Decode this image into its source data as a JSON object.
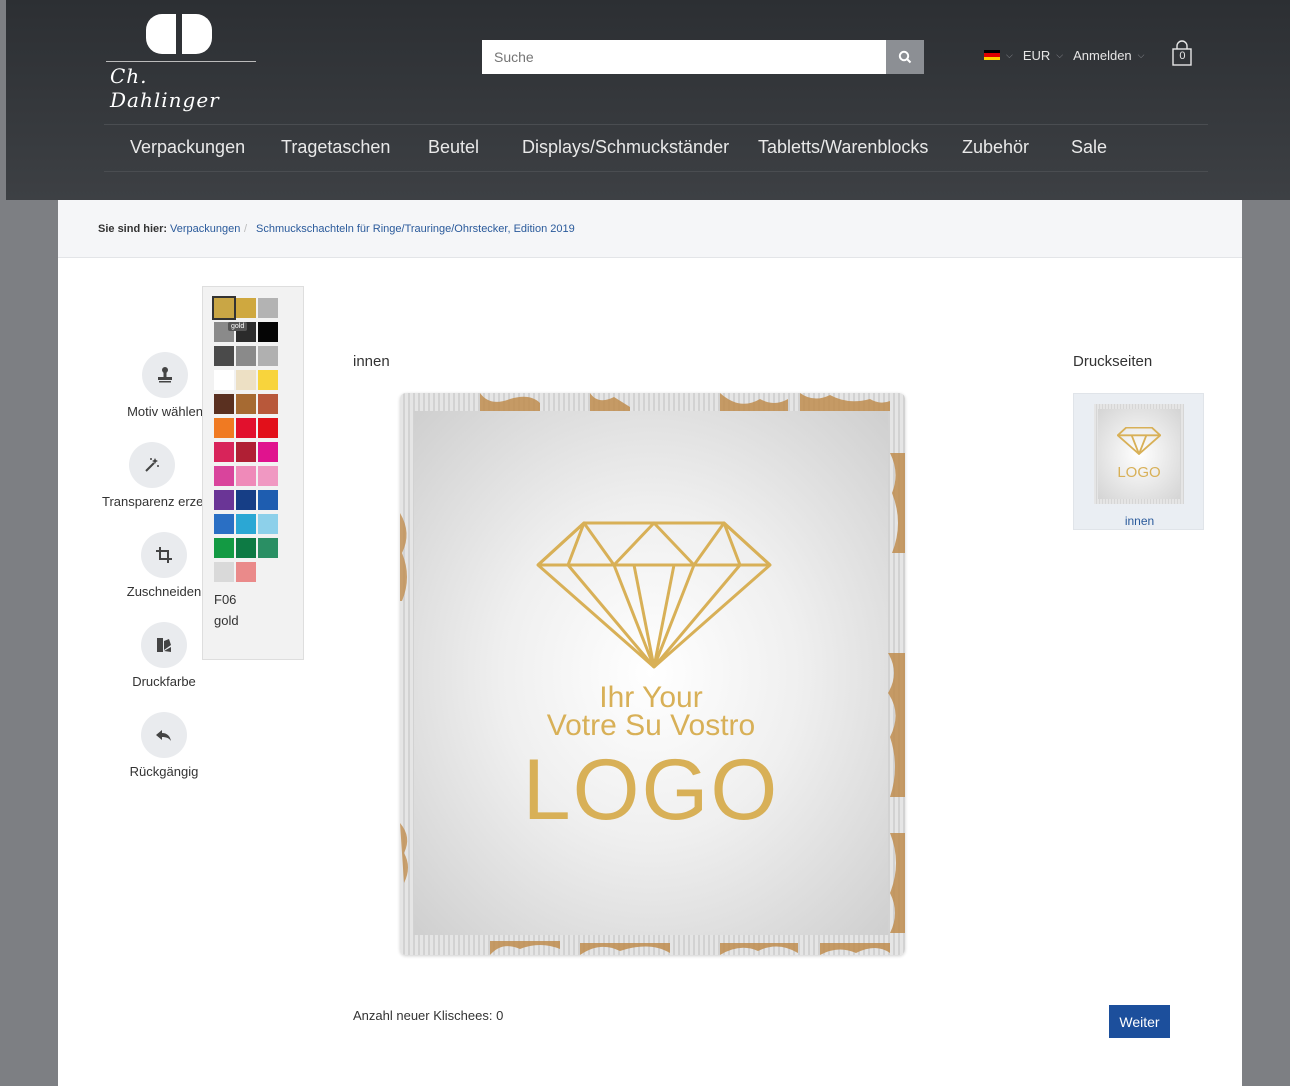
{
  "header": {
    "logo": {
      "script_text": "Ch. Dahlinger"
    },
    "search": {
      "placeholder": "Suche",
      "icon": "search-icon"
    },
    "currency": "EUR",
    "login": "Anmelden",
    "cart_count": "0",
    "flag_colors": [
      "#000000",
      "#dd0000",
      "#ffce00"
    ]
  },
  "nav": {
    "items": [
      "Verpackungen",
      "Tragetaschen",
      "Beutel",
      "Displays/Schmuckständer",
      "Tabletts/Warenblocks",
      "Zubehör",
      "Sale"
    ]
  },
  "breadcrumb": {
    "label": "Sie sind hier:",
    "items": [
      "Verpackungen",
      "Schmuckschachteln für Ringe/Trauringe/Ohrstecker, Edition 2019"
    ],
    "separator": "/"
  },
  "tools": [
    {
      "label": "Motiv wählen",
      "icon": "stamp-icon"
    },
    {
      "label": "Transparenz erzeugen",
      "icon": "magic-wand-icon"
    },
    {
      "label": "Zuschneiden",
      "icon": "crop-icon"
    },
    {
      "label": "Druckfarbe",
      "icon": "color-swatch-icon"
    },
    {
      "label": "Rückgängig",
      "icon": "undo-icon"
    }
  ],
  "palette": {
    "selected_code": "F06",
    "selected_name": "gold",
    "tooltip": "gold",
    "swatches": [
      [
        "#c9a645",
        "#cfa83f",
        "#b3b3b3"
      ],
      [
        "#8a8a8a",
        "#2b2b2b",
        "#050505"
      ],
      [
        "#4a4a4a",
        "#8a8a8a",
        "#b0b0b0"
      ],
      [
        "#ffffff",
        "#ede0c4",
        "#f8d43c"
      ],
      [
        "#5a3020",
        "#a66a32",
        "#b8583a"
      ],
      [
        "#f07a22",
        "#e2102d",
        "#e2101a"
      ],
      [
        "#d8245a",
        "#b01f34",
        "#e0138e"
      ],
      [
        "#d9449c",
        "#ef8ab9",
        "#f098c2"
      ],
      [
        "#6a3596",
        "#163e86",
        "#1e5db0"
      ],
      [
        "#2a6fc4",
        "#2ba7d4",
        "#8dd0ea"
      ],
      [
        "#139a43",
        "#0d7a44",
        "#2a8f64"
      ],
      [
        "#d9d9d9",
        "#ea8a8a"
      ]
    ]
  },
  "canvas": {
    "label": "innen",
    "logo_text": {
      "line1": "Ihr  Your",
      "line2": "Votre  Su  Vostro",
      "line3": "LOGO"
    },
    "accent": "#d8b057"
  },
  "druckseiten": {
    "title": "Druckseiten",
    "items": [
      {
        "label": "innen"
      }
    ]
  },
  "footer": {
    "anzahl": "Anzahl neuer Klischees: 0",
    "weiter": "Weiter"
  }
}
